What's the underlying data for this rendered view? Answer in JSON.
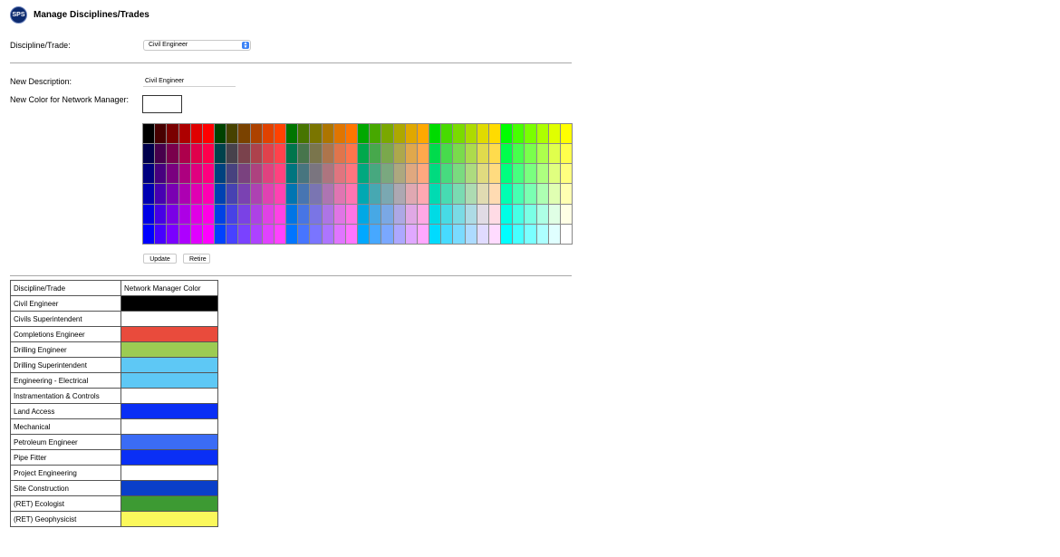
{
  "header": {
    "logo_text": "SPS",
    "title": "Manage Disciplines/Trades"
  },
  "form": {
    "discipline_label": "Discipline/Trade:",
    "discipline_selected": "Civil Engineer",
    "new_description_label": "New Description:",
    "new_description_value": "Civil Engineer",
    "new_color_label": "New Color for Network Manager:",
    "new_color_value": "#ffffff"
  },
  "buttons": {
    "update": "Update",
    "retire": "Retire"
  },
  "table": {
    "headers": [
      "Discipline/Trade",
      "Network Manager Color"
    ],
    "rows": [
      {
        "name": "Civil Engineer",
        "color": "#000000"
      },
      {
        "name": "Civils Superintendent",
        "color": "#ffffff"
      },
      {
        "name": "Completions Engineer",
        "color": "#e94b3c"
      },
      {
        "name": "Drilling Engineer",
        "color": "#9ccb53"
      },
      {
        "name": "Drilling Superintendent",
        "color": "#5ec8f5"
      },
      {
        "name": "Engineering - Electrical",
        "color": "#5ec8f5"
      },
      {
        "name": "Instramentation & Controls",
        "color": "#ffffff"
      },
      {
        "name": "Land Access",
        "color": "#0a2ff5"
      },
      {
        "name": "Mechanical",
        "color": "#ffffff"
      },
      {
        "name": "Petroleum Engineer",
        "color": "#3b6cf5"
      },
      {
        "name": "Pipe Fitter",
        "color": "#0a2ff5"
      },
      {
        "name": "Project Engineering",
        "color": "#ffffff"
      },
      {
        "name": "Site Construction",
        "color": "#0a3fc9"
      },
      {
        "name": "(RET) Ecologist",
        "color": "#3d9a33"
      },
      {
        "name": "(RET) Geophysicist",
        "color": "#fbf85c"
      }
    ]
  }
}
